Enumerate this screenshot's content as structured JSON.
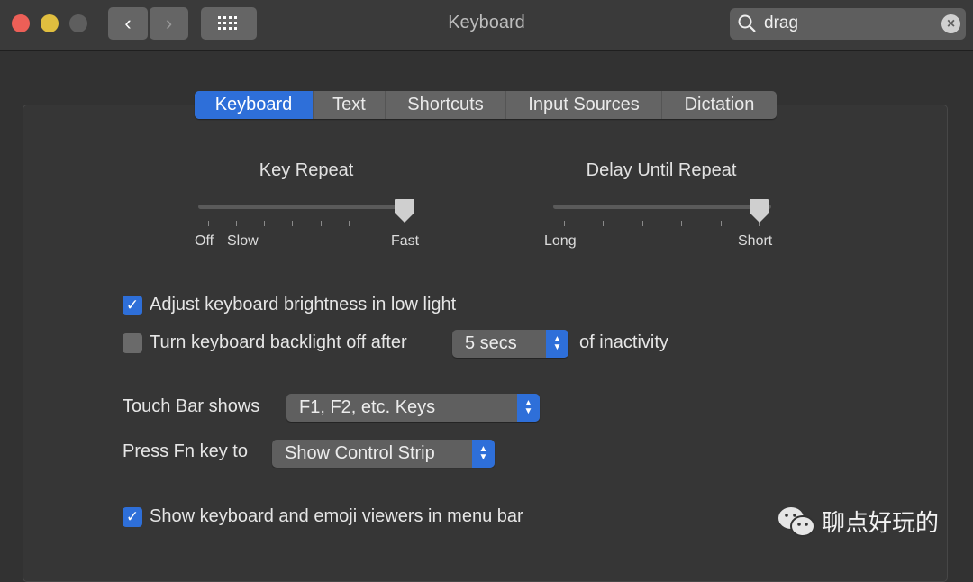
{
  "window": {
    "title": "Keyboard"
  },
  "search": {
    "value": "drag"
  },
  "tabs": [
    {
      "label": "Keyboard",
      "selected": true
    },
    {
      "label": "Text"
    },
    {
      "label": "Shortcuts"
    },
    {
      "label": "Input Sources"
    },
    {
      "label": "Dictation"
    }
  ],
  "key_repeat": {
    "title": "Key Repeat",
    "label_off": "Off",
    "label_slow": "Slow",
    "label_fast": "Fast",
    "value_fraction": 1.0
  },
  "delay_until_repeat": {
    "title": "Delay Until Repeat",
    "label_long": "Long",
    "label_short": "Short",
    "value_fraction": 1.0
  },
  "options": {
    "adjust_brightness": {
      "label": "Adjust keyboard brightness in low light",
      "checked": true
    },
    "backlight_off": {
      "label_before": "Turn keyboard backlight off after",
      "value": "5 secs",
      "label_after": "of inactivity",
      "checked": false
    },
    "touch_bar": {
      "label": "Touch Bar shows",
      "value": "F1, F2, etc. Keys"
    },
    "fn_key": {
      "label": "Press Fn key to",
      "value": "Show Control Strip"
    },
    "show_viewers": {
      "label": "Show keyboard and emoji viewers in menu bar",
      "checked": true
    }
  },
  "watermark": {
    "text": "聊点好玩的"
  },
  "colors": {
    "accent": "#2e6fd9",
    "close": "#ec5f57",
    "minimize": "#e0be3f"
  }
}
